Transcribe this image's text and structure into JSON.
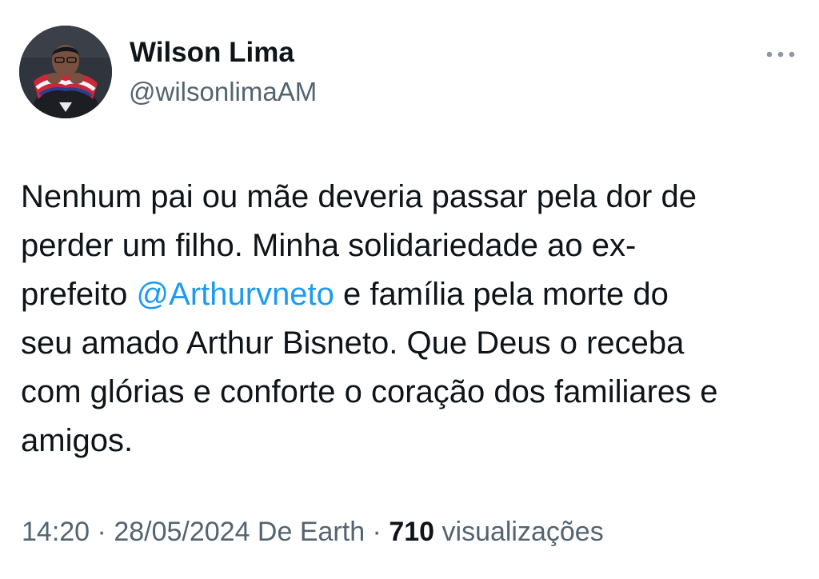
{
  "author": {
    "name": "Wilson Lima",
    "handle": "@wilsonlimaAM",
    "avatar_icon": "profile-photo"
  },
  "more_icon": "more-options-icon",
  "tweet": {
    "lines": [
      {
        "before": "Nenhum pai ou mãe deveria passar pela dor de",
        "mention": "",
        "after": ""
      },
      {
        "before": "perder um filho. Minha solidariedade ao ex-",
        "mention": "",
        "after": ""
      },
      {
        "before": "prefeito ",
        "mention": "@Arthurvneto",
        "after": " e família pela morte do"
      },
      {
        "before": "seu amado Arthur Bisneto. Que Deus o receba",
        "mention": "",
        "after": ""
      },
      {
        "before": "com glórias e conforte o coração dos familiares e",
        "mention": "",
        "after": ""
      },
      {
        "before": "amigos.",
        "mention": "",
        "after": ""
      }
    ]
  },
  "meta": {
    "time": "14:20",
    "separator1": " · ",
    "date": "28/05/2024",
    "source": " De Earth",
    "separator2": " · ",
    "views_count": "710",
    "views_label": " visualizações"
  },
  "colors": {
    "text": "#0f1419",
    "secondary": "#536471",
    "link": "#1d9bf0"
  }
}
